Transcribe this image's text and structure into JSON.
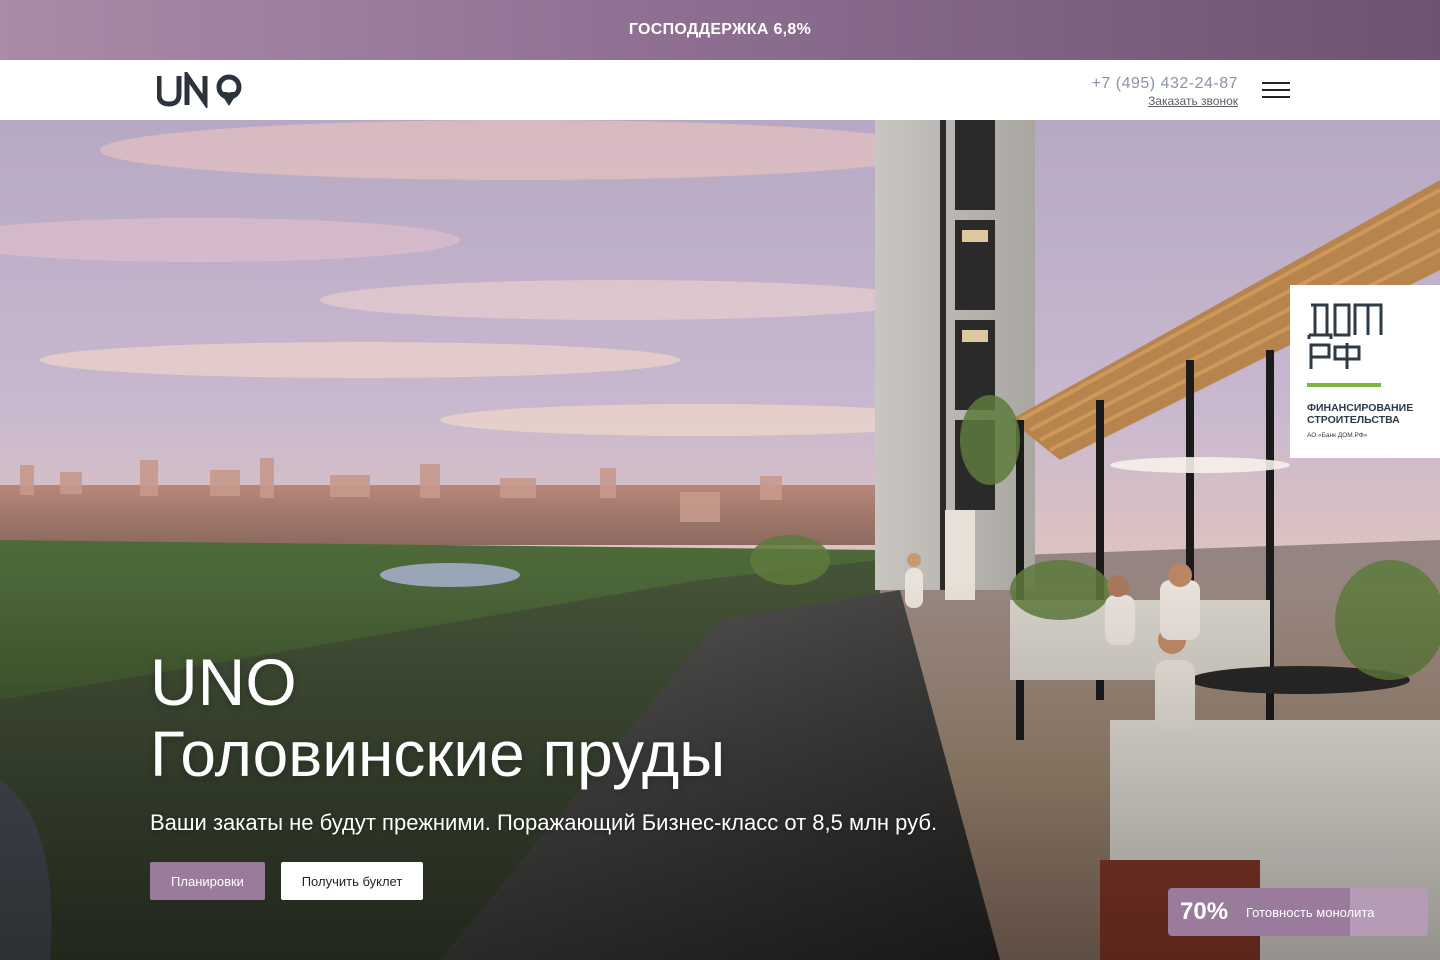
{
  "promo": {
    "text": "ГОСПОДДЕРЖКА 6,8%"
  },
  "header": {
    "logo_text": "UNO",
    "phone": "+7 (495) 432-24-87",
    "callback_label": "Заказать звонок"
  },
  "hero": {
    "title_line1": "UNO",
    "title_line2": "Головинские пруды",
    "subtitle": "Ваши закаты не будут прежними. Поражающий Бизнес-класс от 8,5 млн руб.",
    "btn_plans": "Планировки",
    "btn_booklet": "Получить буклет"
  },
  "badge": {
    "logo_line1": "ДОМ",
    "logo_line2": "РФ",
    "title": "ФИНАНСИРОВАНИЕ СТРОИТЕЛЬСТВА",
    "subtitle": "АО «Банк ДОМ.РФ»"
  },
  "readiness": {
    "percent": "70%",
    "label": "Готовность монолита",
    "value": 0.7
  },
  "colors": {
    "accent": "#9b7b9c",
    "promo_dark": "#6d5470",
    "domrf_green": "#7cb342"
  }
}
